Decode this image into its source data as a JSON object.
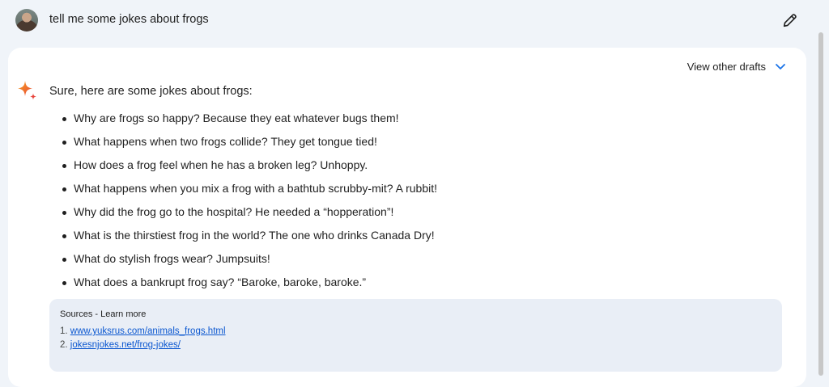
{
  "prompt": {
    "text": "tell me some jokes about frogs",
    "avatar_icon": "user-avatar",
    "edit_icon": "pencil-icon"
  },
  "response": {
    "drafts_label": "View other drafts",
    "drafts_icon": "chevron-down-icon",
    "assistant_icon": "gemini-sparkle-icon",
    "intro": "Sure, here are some jokes about frogs:",
    "jokes": [
      "Why are frogs so happy? Because they eat whatever bugs them!",
      "What happens when two frogs collide? They get tongue tied!",
      "How does a frog feel when he has a broken leg? Unhoppy.",
      "What happens when you mix a frog with a bathtub scrubby-mit? A rubbit!",
      "Why did the frog go to the hospital? He needed a “hopperation”!",
      "What is the thirstiest frog in the world? The one who drinks Canada Dry!",
      "What do stylish frogs wear? Jumpsuits!",
      "What does a bankrupt frog say? “Baroke, baroke, baroke.”"
    ],
    "sources": {
      "title": "Sources",
      "separator": " - ",
      "learn_more": "Learn more",
      "items": [
        {
          "number": "1.",
          "link": "www.yuksrus.com/animals_frogs.html"
        },
        {
          "number": "2.",
          "link": "jokesnjokes.net/frog-jokes/"
        }
      ]
    }
  },
  "colors": {
    "page_background": "#f0f4f9",
    "card_background": "#ffffff",
    "sources_background": "#e9eef6",
    "link": "#0b57d0",
    "accent_blue": "#1a73e8"
  }
}
